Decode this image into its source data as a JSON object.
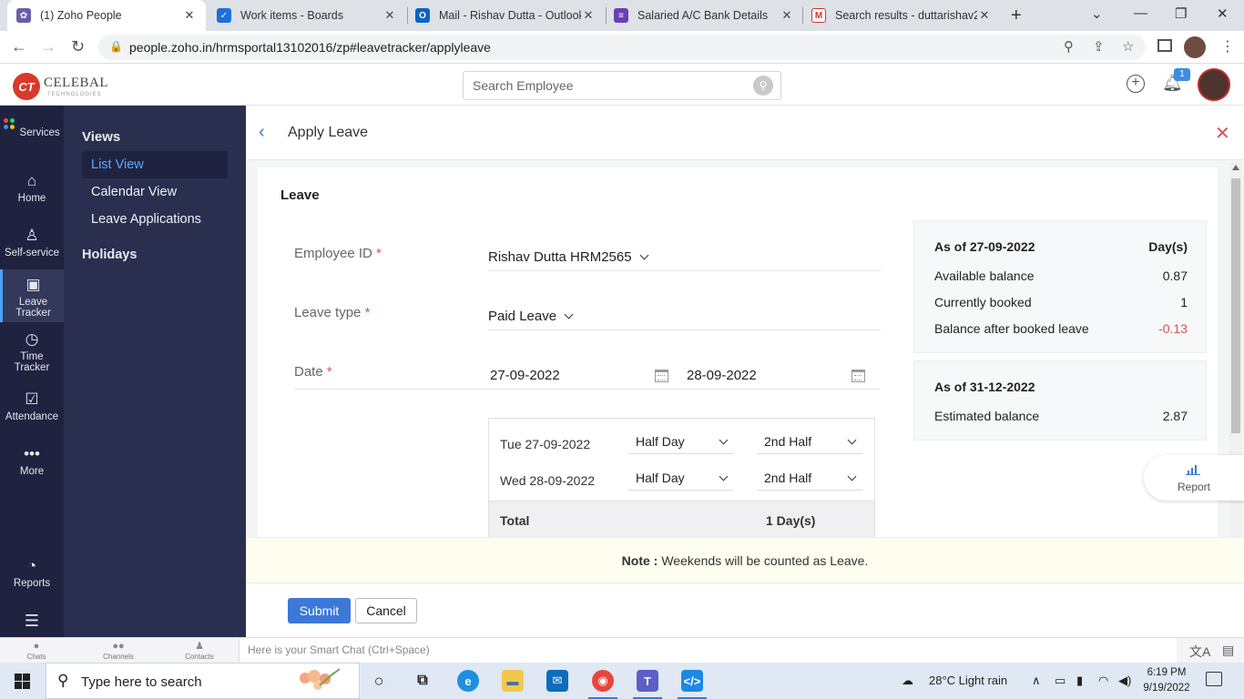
{
  "browser": {
    "tabs": [
      {
        "title": "(1) Zoho People",
        "icon": "zoho-people-icon",
        "color": "#6b5ea8"
      },
      {
        "title": "Work items - Boards",
        "icon": "azure-boards-icon",
        "color": "#1e6fd9"
      },
      {
        "title": "Mail - Rishav Dutta - Outlook",
        "icon": "outlook-icon",
        "color": "#0a64c4"
      },
      {
        "title": "Salaried A/C Bank Details",
        "icon": "forms-icon",
        "color": "#6a3fb5"
      },
      {
        "title": "Search results - duttarishav2",
        "icon": "gmail-icon",
        "color": "#d93025"
      }
    ],
    "url": "people.zoho.in/hrmsportal13102016/zp#leavetracker/applyleave"
  },
  "app_header": {
    "logo_mark": "CT",
    "logo_text": "CELEBAL",
    "logo_sub": "TECHNOLOGIES",
    "search_placeholder": "Search Employee",
    "notification_count": "1"
  },
  "rail": {
    "items": [
      {
        "label": "Services",
        "icon": "services-icon"
      },
      {
        "label": "Home",
        "icon": "home-icon"
      },
      {
        "label": "Self-service",
        "icon": "person-icon"
      },
      {
        "label": "Leave Tracker",
        "icon": "calendar-icon",
        "active": true
      },
      {
        "label": "Time Tracker",
        "icon": "clock-icon"
      },
      {
        "label": "Attendance",
        "icon": "attendance-icon"
      },
      {
        "label": "More",
        "icon": "more-icon"
      },
      {
        "label": "Reports",
        "icon": "reports-icon"
      }
    ]
  },
  "subnav": {
    "views_heading": "Views",
    "items": [
      "List View",
      "Calendar View",
      "Leave Applications"
    ],
    "holidays": "Holidays"
  },
  "page": {
    "title": "Apply Leave",
    "section_title": "Leave",
    "fields": {
      "employee_id": {
        "label": "Employee ID",
        "value": "Rishav Dutta HRM2565"
      },
      "leave_type": {
        "label": "Leave type",
        "value": "Paid Leave"
      },
      "date": {
        "label": "Date",
        "from": "27-09-2022",
        "to": "28-09-2022"
      },
      "required_mark": "*"
    },
    "day_rows": [
      {
        "date": "Tue 27-09-2022",
        "type": "Half Day",
        "half": "2nd Half"
      },
      {
        "date": "Wed 28-09-2022",
        "type": "Half Day",
        "half": "2nd Half"
      }
    ],
    "total": {
      "label": "Total",
      "value": "1 Day(s)"
    },
    "balance": {
      "as_of": "As of 27-09-2022",
      "unit_header": "Day(s)",
      "rows": [
        {
          "label": "Available balance",
          "value": "0.87"
        },
        {
          "label": "Currently booked",
          "value": "1"
        },
        {
          "label": "Balance after booked leave",
          "value": "-0.13"
        }
      ]
    },
    "estimate": {
      "as_of": "As of 31-12-2022",
      "label": "Estimated balance",
      "value": "2.87"
    },
    "report_label": "Report",
    "note": {
      "label": "Note :",
      "text": "Weekends will be counted as Leave."
    },
    "buttons": {
      "submit": "Submit",
      "cancel": "Cancel"
    }
  },
  "chat": {
    "items": [
      "Chats",
      "Channels",
      "Contacts"
    ],
    "smart_placeholder": "Here is your Smart Chat (Ctrl+Space)"
  },
  "taskbar": {
    "search_text": "Type here to search",
    "weather": "28°C  Light rain",
    "time": "6:19 PM",
    "date": "9/19/2022"
  },
  "colors": {
    "rail_bg": "#1f2340",
    "subnav_bg": "#2a2f50",
    "accent": "#3b78d8",
    "negative": "#e05050"
  }
}
